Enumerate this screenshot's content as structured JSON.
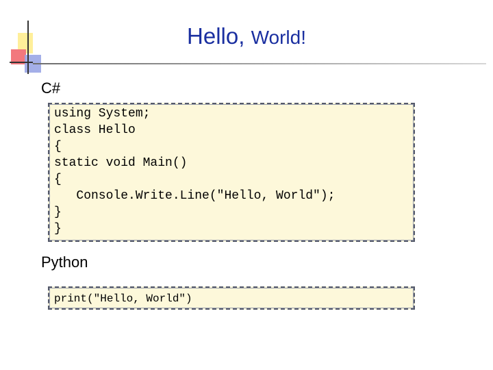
{
  "slide": {
    "title_main": "Hello, ",
    "title_tail": "World!"
  },
  "sections": [
    {
      "heading": "C#",
      "code_lines": [
        "using System;",
        "class Hello",
        "{",
        "static void Main()",
        "{",
        "   Console.Write.Line(\"Hello, World\");",
        "}",
        "}"
      ]
    },
    {
      "heading": "Python",
      "code_lines": [
        "print(\"Hello, World\")"
      ]
    }
  ],
  "colors": {
    "title": "#1a2fa0",
    "code_background": "#fdf8da",
    "decor_yellow": "#ffef9a",
    "decor_red": "#f2787d",
    "decor_blue": "#9aa6e6"
  }
}
